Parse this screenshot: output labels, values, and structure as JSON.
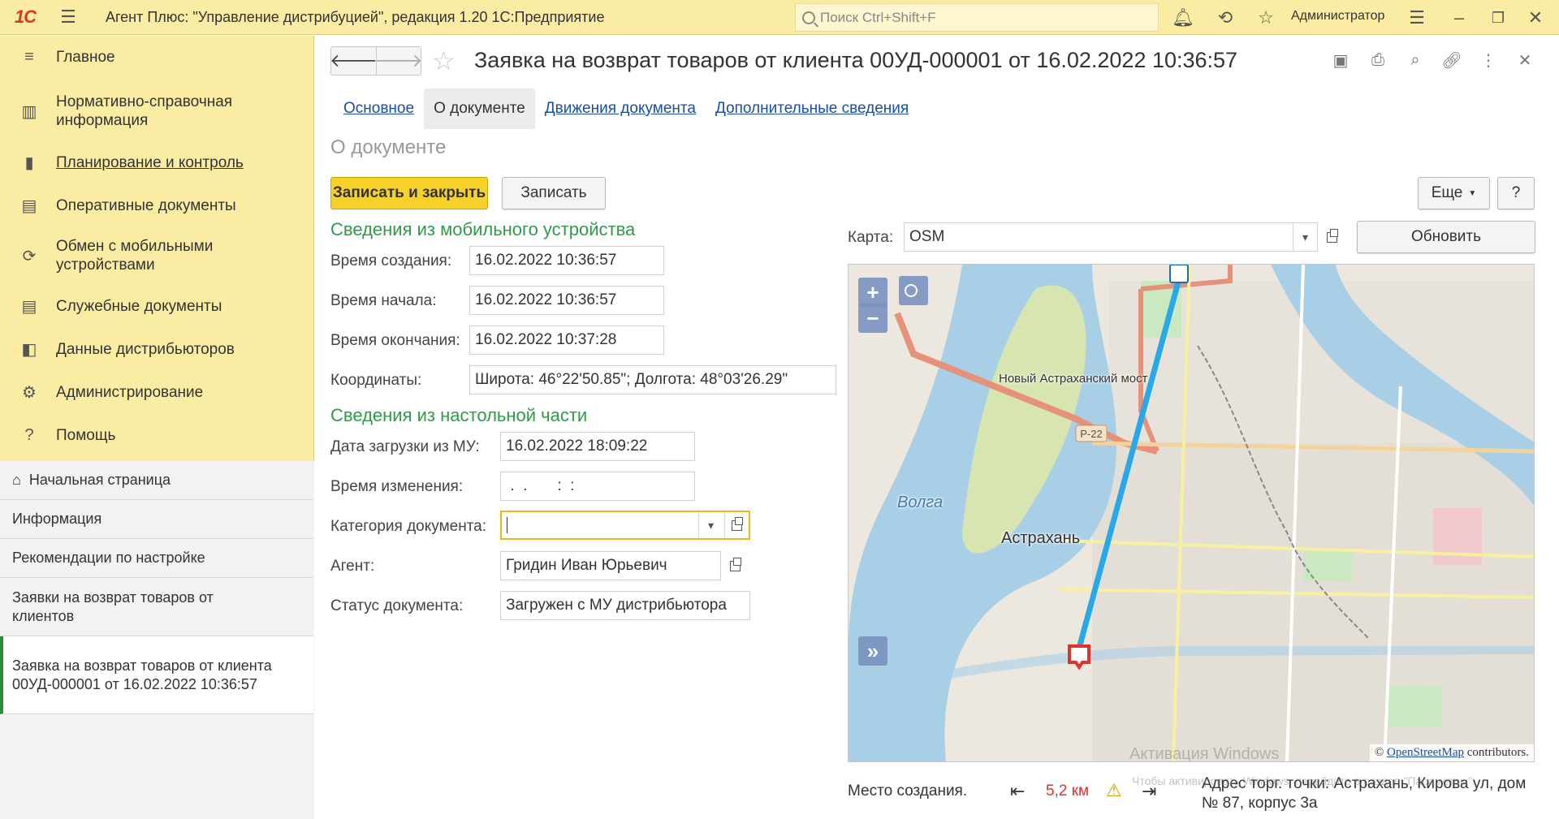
{
  "app": {
    "logo": "1С",
    "title": "Агент Плюс: \"Управление дистрибуцией\", редакция 1.20 1С:Предприятие",
    "search_placeholder": "Поиск Ctrl+Shift+F",
    "user": "Администратор",
    "icons": [
      "bell-icon",
      "history-icon",
      "star-icon",
      "settings-icon",
      "minimize-icon",
      "restore-icon",
      "close-icon"
    ]
  },
  "sidebar": {
    "items": [
      {
        "label": "Главное",
        "icon": "menu-icon"
      },
      {
        "label": "Нормативно-справочная информация",
        "icon": "catalog-icon"
      },
      {
        "label": "Планирование и контроль",
        "icon": "chart-icon"
      },
      {
        "label": "Оперативные документы",
        "icon": "documents-icon"
      },
      {
        "label": "Обмен с мобильными устройствами",
        "icon": "sync-icon"
      },
      {
        "label": "Служебные документы",
        "icon": "service-docs-icon"
      },
      {
        "label": "Данные дистрибьюторов",
        "icon": "distributors-icon"
      },
      {
        "label": "Администрирование",
        "icon": "gear-icon"
      },
      {
        "label": "Помощь",
        "icon": "help-icon"
      }
    ],
    "open_windows": [
      {
        "label": "Начальная страница",
        "icon": "home-icon"
      },
      {
        "label": "Информация"
      },
      {
        "label": "Рекомендации по настройке"
      },
      {
        "label": "Заявки на возврат товаров от клиентов"
      },
      {
        "label": "Заявка на возврат товаров от клиента 00УД-000001 от 16.02.2022 10:36:57"
      }
    ]
  },
  "form": {
    "title": "Заявка на возврат товаров от клиента 00УД-000001 от 16.02.2022 10:36:57",
    "tabs": [
      "Основное",
      "О документе",
      "Движения документа",
      "Дополнительные сведения"
    ],
    "active_tab": "О документе",
    "section_title": "О документе",
    "save_close_label": "Записать и закрыть",
    "save_label": "Записать",
    "more_label": "Еще",
    "help_label": "?",
    "mobile_group": "Сведения из мобильного устройства",
    "created_label": "Время создания:",
    "created_value": "16.02.2022 10:36:57",
    "start_label": "Время начала:",
    "start_value": "16.02.2022 10:36:57",
    "end_label": "Время окончания:",
    "end_value": "16.02.2022 10:37:28",
    "coords_label": "Координаты:",
    "coords_value": "Широта: 46°22'50.85\"; Долгота: 48°03'26.29\"",
    "desktop_group": "Сведения из настольной части",
    "load_label": "Дата загрузки из МУ:",
    "load_value": "16.02.2022 18:09:22",
    "changed_label": "Время изменения:",
    "changed_value": " .  .       :  :",
    "category_label": "Категория документа:",
    "category_value": "",
    "agent_label": "Агент:",
    "agent_value": "Гридин Иван Юрьевич",
    "status_label": "Статус документа:",
    "status_value": "Загружен с МУ дистрибьютора"
  },
  "map": {
    "map_label": "Карта:",
    "map_value": "OSM",
    "refresh_label": "Обновить",
    "zoom_in": "+",
    "zoom_out": "−",
    "expand": "»",
    "city": "Астрахань",
    "river": "Волга",
    "bridge": "Новый Астраханский мост",
    "road": "Р-22",
    "attribution_link": "OpenStreetMap",
    "attribution_rest": "contributors.",
    "watermark_1": "Активация Windows",
    "watermark_2": "Чтобы активировать Windows, перейдите в раздел \"Параметры\"."
  },
  "footer": {
    "place_label": "Место создания.",
    "distance": "5,2 км",
    "address": "Адрес торг. точки: Астрахань, Кирова ул, дом № 87, корпус 3а"
  },
  "colors": {
    "accent_yellow": "#f6d12a",
    "sidebar_bg": "#fbeca4",
    "group_green": "#2e9c47",
    "link_blue": "#1a4ea3",
    "distance_red": "#e0312b",
    "route_blue": "#29a8e8"
  }
}
